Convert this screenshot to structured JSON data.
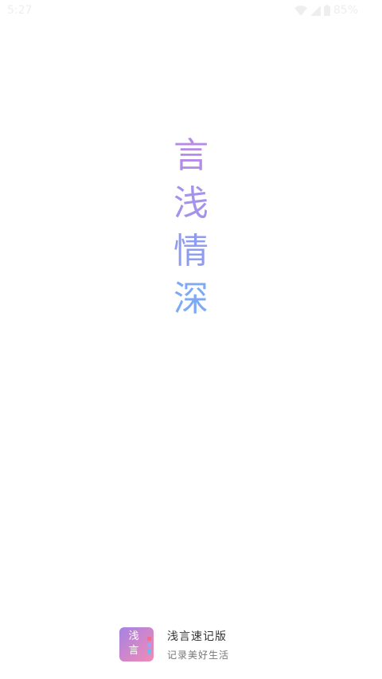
{
  "status_bar": {
    "time": "5:27",
    "battery": "85%",
    "icon_color": "#eeeeee"
  },
  "slogan": {
    "chars": [
      "言",
      "浅",
      "情",
      "深"
    ],
    "colors": [
      "#b68be8",
      "#a592ec",
      "#8f9cf0",
      "#7eaaf3"
    ]
  },
  "brand": {
    "icon_text_line1": "浅",
    "icon_text_line2": "言",
    "name": "浅言速记版",
    "tagline": "记录美好生活",
    "icon_gradient": [
      "#a483e4",
      "#f08bb8"
    ],
    "icon_dot_colors": [
      "#f26d8b",
      "#9aa5f5",
      "#5cc3f0"
    ]
  }
}
